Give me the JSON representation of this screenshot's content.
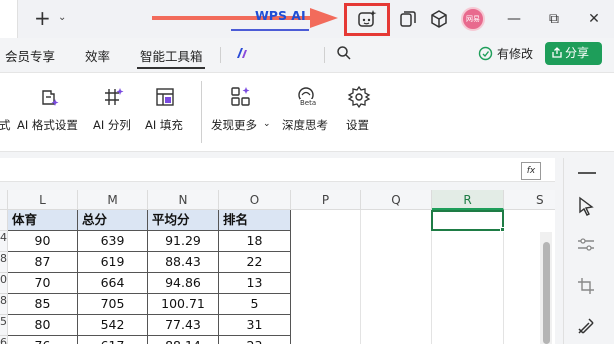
{
  "titlebar": {
    "new_tab_label": "+",
    "new_tab_chevron": "⌄",
    "avatar_text": "网易",
    "icons": [
      "ai-assistant-icon",
      "window-icon",
      "cube-icon"
    ],
    "window_controls": {
      "minimize": "—",
      "restore": "⧉",
      "close": "✕"
    }
  },
  "menubar": {
    "items": [
      "会员专享",
      "效率",
      "智能工具箱"
    ],
    "wps_ai": "WPS AI",
    "modify_status": "有修改",
    "share": "分享"
  },
  "ribbon": {
    "items": [
      {
        "label": "式",
        "icon": "truncated"
      },
      {
        "label": "AI 格式设置",
        "icon": "ai-format-icon"
      },
      {
        "label": "AI 分列",
        "icon": "ai-split-icon"
      },
      {
        "label": "AI 填充",
        "icon": "ai-fill-icon"
      },
      {
        "label": "发现更多",
        "icon": "discover-more-icon"
      },
      {
        "label": "深度思考",
        "icon": "deep-think-icon"
      },
      {
        "label": "设置",
        "icon": "settings-icon"
      }
    ],
    "discover_chevron": "⌄",
    "beta_badge": "Beta"
  },
  "formulabar": {
    "fx": "fx"
  },
  "grid": {
    "columns": [
      "L",
      "M",
      "N",
      "O",
      "P",
      "Q",
      "R",
      "S"
    ],
    "row_numbers": [
      "",
      "4",
      "8",
      "0",
      "8",
      "5",
      "6"
    ],
    "headers": [
      "体育",
      "总分",
      "平均分",
      "排名"
    ],
    "rows": [
      [
        "90",
        "639",
        "91.29",
        "18"
      ],
      [
        "87",
        "619",
        "88.43",
        "22"
      ],
      [
        "70",
        "664",
        "94.86",
        "13"
      ],
      [
        "85",
        "705",
        "100.71",
        "5"
      ],
      [
        "80",
        "542",
        "77.43",
        "31"
      ],
      [
        "76",
        "617",
        "88.14",
        "23"
      ]
    ]
  }
}
